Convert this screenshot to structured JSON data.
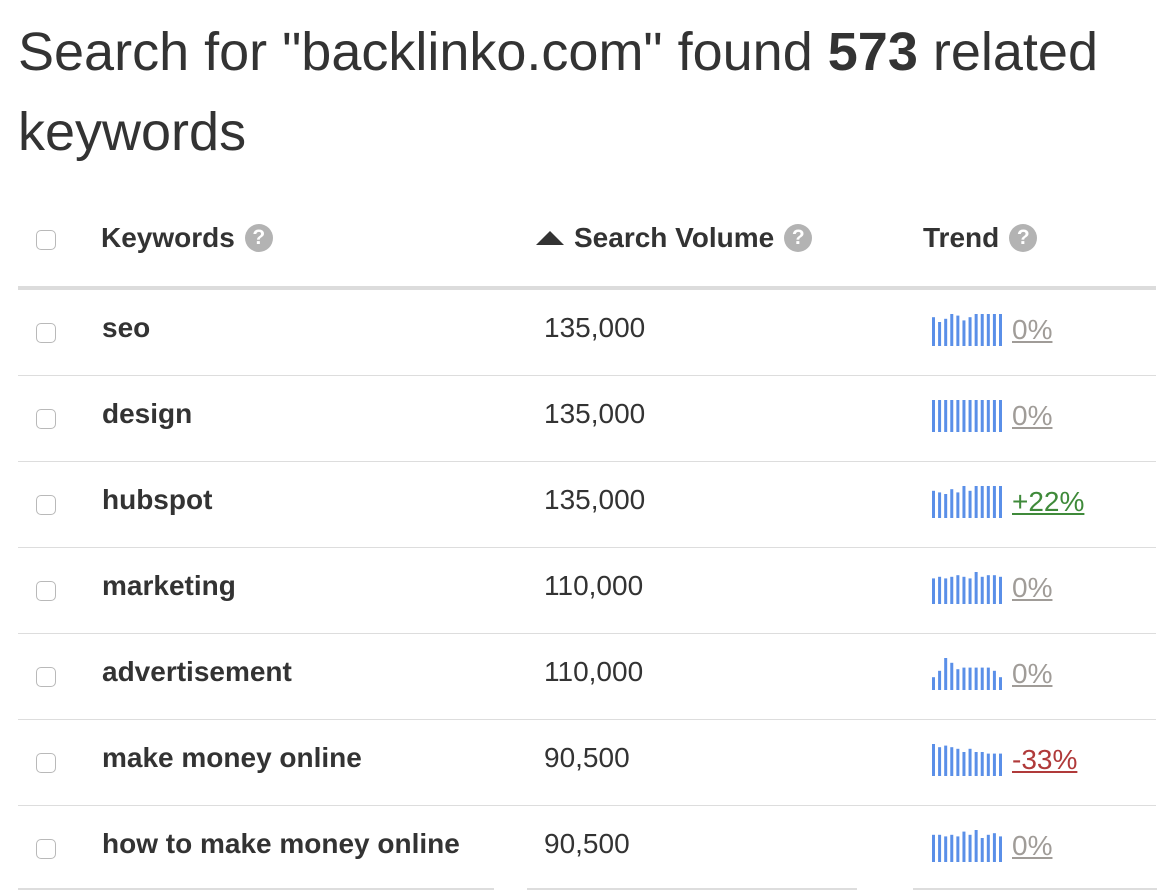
{
  "headline": {
    "prefix": "Search for \"backlinko.com\" found ",
    "count": "573",
    "suffix": " related keywords"
  },
  "columns": {
    "keywords": "Keywords",
    "search_volume": "Search Volume",
    "trend": "Trend",
    "help_glyph": "?"
  },
  "colors": {
    "spark_bar": "#5a8fe8",
    "neutral": "#a09c98",
    "positive": "#3f8a3a",
    "negative": "#b03a3a"
  },
  "rows": [
    {
      "keyword": "seo",
      "volume": "135,000",
      "trend_pct": "0%",
      "trend_kind": "neutral",
      "spark": [
        0.9,
        0.75,
        0.85,
        1.0,
        0.95,
        0.8,
        0.9,
        1.0,
        1.0,
        1.0,
        1.0,
        1.0
      ]
    },
    {
      "keyword": "design",
      "volume": "135,000",
      "trend_pct": "0%",
      "trend_kind": "neutral",
      "spark": [
        1.0,
        1.0,
        1.0,
        1.0,
        1.0,
        1.0,
        1.0,
        1.0,
        1.0,
        1.0,
        1.0,
        1.0
      ]
    },
    {
      "keyword": "hubspot",
      "volume": "135,000",
      "trend_pct": "+22%",
      "trend_kind": "positive",
      "spark": [
        0.85,
        0.8,
        0.75,
        0.9,
        0.8,
        1.0,
        0.85,
        1.0,
        1.0,
        1.0,
        1.0,
        1.0
      ]
    },
    {
      "keyword": "marketing",
      "volume": "110,000",
      "trend_pct": "0%",
      "trend_kind": "neutral",
      "spark": [
        0.8,
        0.85,
        0.8,
        0.85,
        0.9,
        0.85,
        0.8,
        1.0,
        0.85,
        0.9,
        0.9,
        0.85
      ]
    },
    {
      "keyword": "advertisement",
      "volume": "110,000",
      "trend_pct": "0%",
      "trend_kind": "neutral",
      "spark": [
        0.4,
        0.6,
        1.0,
        0.85,
        0.65,
        0.7,
        0.7,
        0.7,
        0.7,
        0.7,
        0.6,
        0.4
      ]
    },
    {
      "keyword": "make money online",
      "volume": "90,500",
      "trend_pct": "-33%",
      "trend_kind": "negative",
      "spark": [
        1.0,
        0.9,
        0.95,
        0.9,
        0.85,
        0.75,
        0.85,
        0.75,
        0.75,
        0.7,
        0.7,
        0.7
      ]
    },
    {
      "keyword": "how to make money online",
      "volume": "90,500",
      "trend_pct": "0%",
      "trend_kind": "neutral",
      "spark": [
        0.85,
        0.85,
        0.8,
        0.85,
        0.8,
        0.95,
        0.85,
        1.0,
        0.75,
        0.85,
        0.9,
        0.8
      ]
    }
  ]
}
